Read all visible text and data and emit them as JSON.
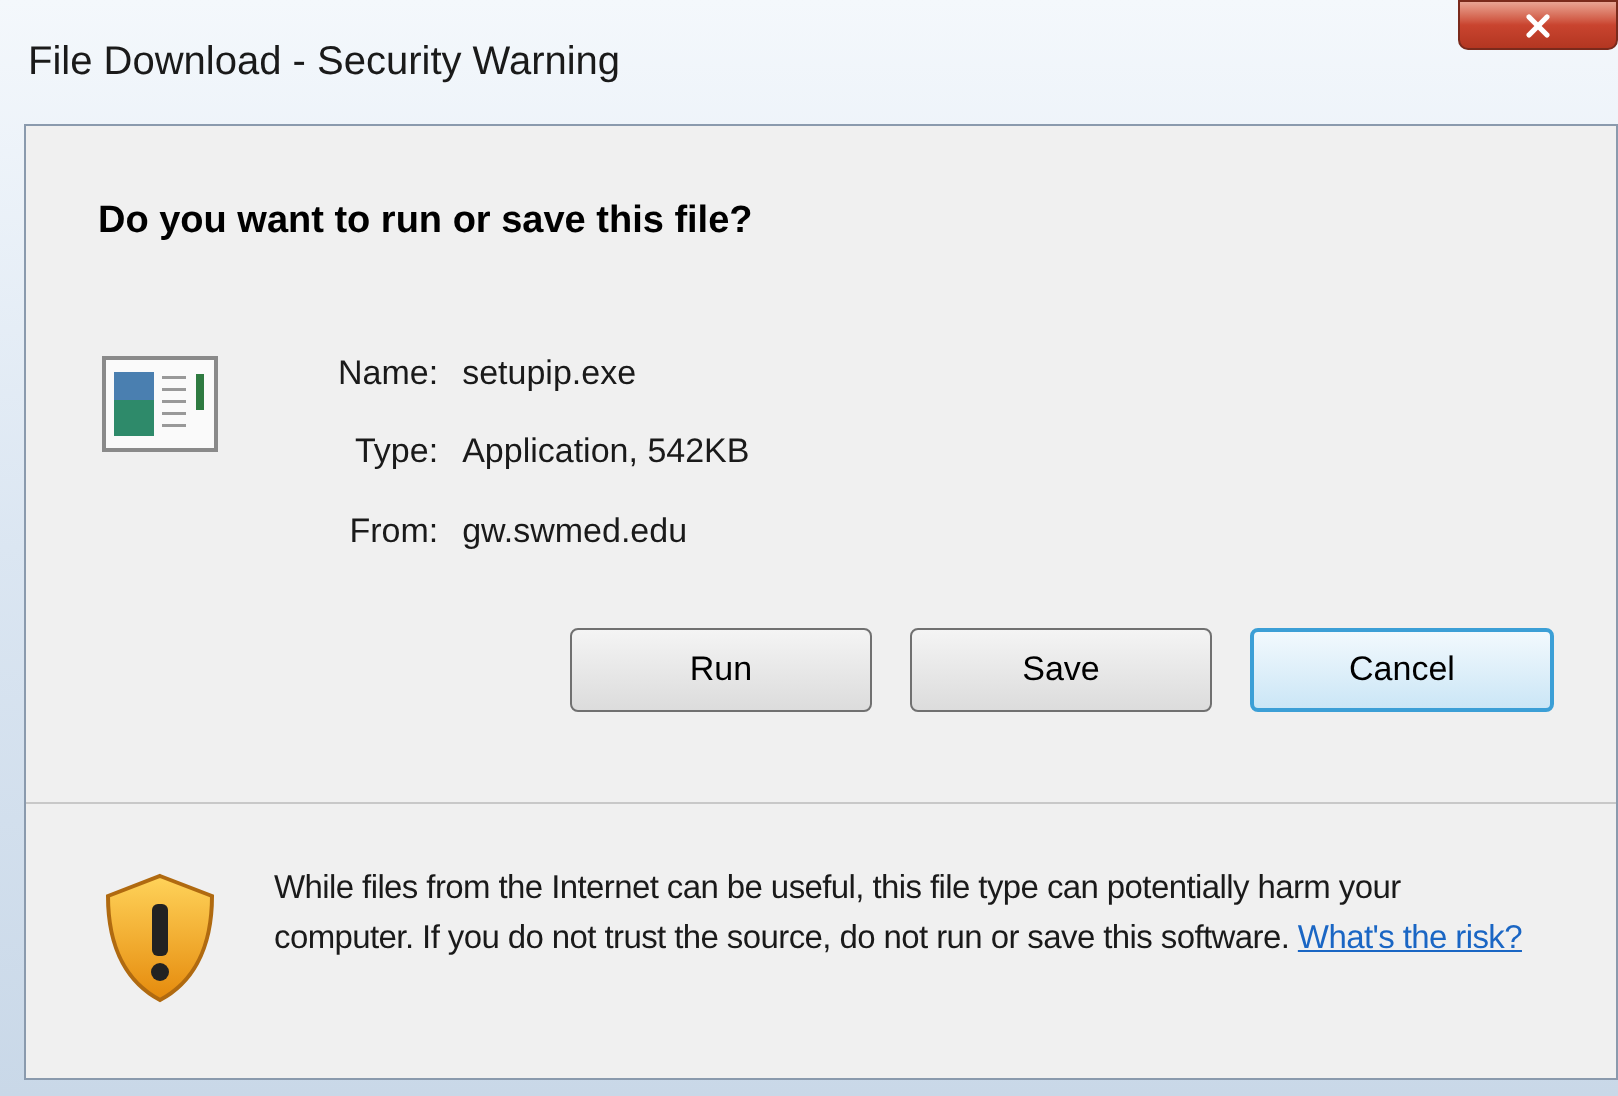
{
  "window": {
    "title": "File Download - Security Warning"
  },
  "heading": "Do you want to run or save this file?",
  "fields": [
    {
      "label": "Name:",
      "value": "setupip.exe"
    },
    {
      "label": "Type:",
      "value": "Application, 542KB"
    },
    {
      "label": "From:",
      "value": "gw.swmed.edu"
    }
  ],
  "buttons": [
    {
      "label": "Run",
      "focused": false
    },
    {
      "label": "Save",
      "focused": false
    },
    {
      "label": "Cancel",
      "focused": true
    }
  ],
  "warning": {
    "text": "While files from the Internet can be useful, this file type can potentially harm your computer. If you do not trust the source, do not run or save this software.",
    "link": "What's the risk?"
  }
}
